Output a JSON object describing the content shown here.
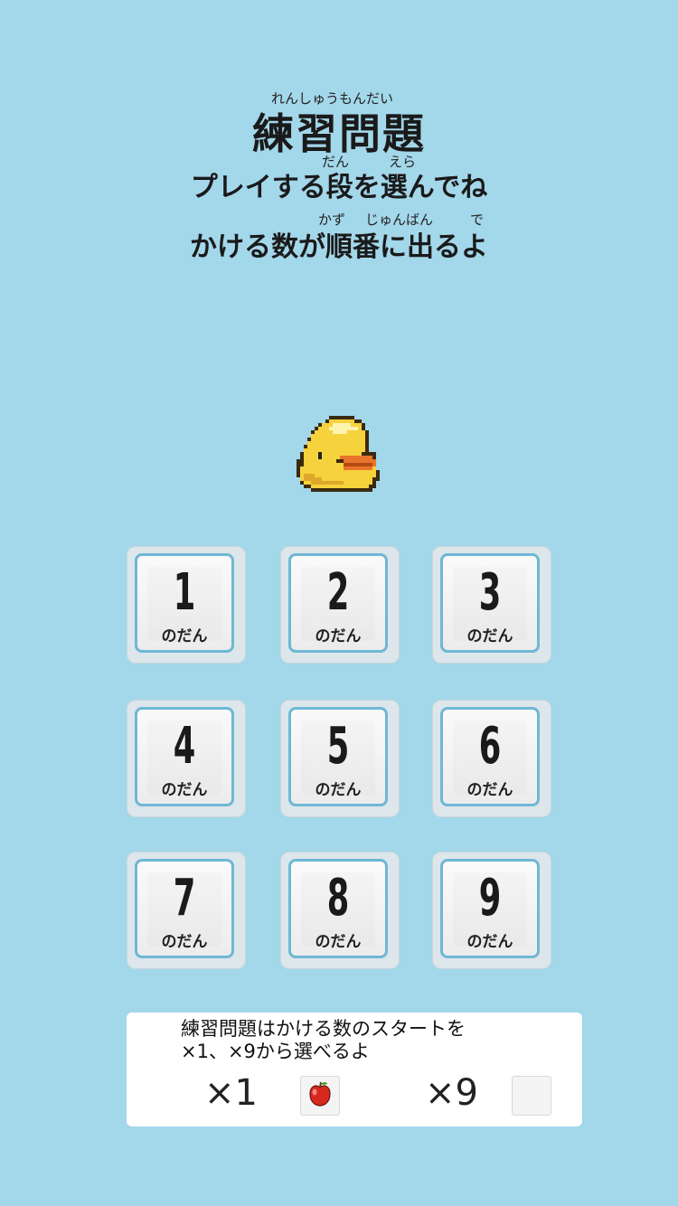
{
  "header": {
    "title": "練習問題",
    "title_ruby": "れんしゅうもんだい",
    "line1": "プレイする段を選んでね",
    "line1_ruby_dan": "だん",
    "line1_ruby_erabu": "えら",
    "line2": "かける数が順番に出るよ",
    "line2_ruby_kazu": "かず",
    "line2_ruby_junban": "じゅんばん",
    "line2_ruby_deru": "で"
  },
  "buttons": [
    {
      "num": "1",
      "label": "のだん"
    },
    {
      "num": "2",
      "label": "のだん"
    },
    {
      "num": "3",
      "label": "のだん"
    },
    {
      "num": "4",
      "label": "のだん"
    },
    {
      "num": "5",
      "label": "のだん"
    },
    {
      "num": "6",
      "label": "のだん"
    },
    {
      "num": "7",
      "label": "のだん"
    },
    {
      "num": "8",
      "label": "のだん"
    },
    {
      "num": "9",
      "label": "のだん"
    }
  ],
  "info": {
    "text_line1": "練習問題はかける数のスタートを",
    "text_line2": "×1、×9から選べるよ",
    "option1_label": "×1",
    "option1_icon": "apple-icon",
    "option2_label": "×9",
    "option2_icon": "empty-checkbox"
  },
  "colors": {
    "background": "#a3d7ea",
    "button_border": "#6fb7d6",
    "chick_yellow": "#f6d23c",
    "chick_beak": "#e9742b"
  }
}
